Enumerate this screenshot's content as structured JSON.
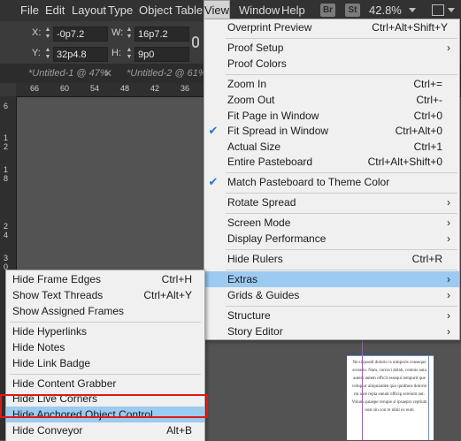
{
  "menubar": {
    "items": [
      "File",
      "Edit",
      "Layout",
      "Type",
      "Object",
      "Table",
      "View",
      "Window",
      "Help"
    ],
    "active": "View",
    "badges": [
      "Br",
      "St"
    ],
    "zoom": "42.8%"
  },
  "control": {
    "x_label": "X:",
    "x_value": "-0p7.2",
    "y_label": "Y:",
    "y_value": "32p4.8",
    "w_label": "W:",
    "w_value": "16p7.2",
    "h_label": "H:",
    "h_value": "9p0"
  },
  "tabs": [
    {
      "label": "*Untitled-1 @ 47%"
    },
    {
      "label": "*Untitled-2 @ 61%"
    }
  ],
  "ruler": {
    "h_ticks": [
      "66",
      "60",
      "54",
      "48",
      "42",
      "36"
    ],
    "v_ticks": [
      "6",
      "1",
      "2",
      "1",
      "8",
      "2",
      "4",
      "3",
      "0",
      "3"
    ]
  },
  "view_menu": {
    "items": [
      {
        "label": "Overprint Preview",
        "shortcut": "Ctrl+Alt+Shift+Y"
      },
      {
        "label": "Proof Setup",
        "submenu": true
      },
      {
        "label": "Proof Colors"
      },
      {
        "label": "Zoom In",
        "shortcut": "Ctrl+="
      },
      {
        "label": "Zoom Out",
        "shortcut": "Ctrl+-"
      },
      {
        "label": "Fit Page in Window",
        "shortcut": "Ctrl+0"
      },
      {
        "label": "Fit Spread in Window",
        "shortcut": "Ctrl+Alt+0",
        "checked": true
      },
      {
        "label": "Actual Size",
        "shortcut": "Ctrl+1"
      },
      {
        "label": "Entire Pasteboard",
        "shortcut": "Ctrl+Alt+Shift+0"
      },
      {
        "label": "Match Pasteboard to Theme Color",
        "checked": true
      },
      {
        "label": "Rotate Spread",
        "submenu": true
      },
      {
        "label": "Screen Mode",
        "submenu": true
      },
      {
        "label": "Display Performance",
        "submenu": true
      },
      {
        "label": "Hide Rulers",
        "shortcut": "Ctrl+R"
      },
      {
        "label": "Extras",
        "submenu": true,
        "highlighted": true
      },
      {
        "label": "Grids & Guides",
        "submenu": true
      },
      {
        "label": "Structure",
        "submenu": true
      },
      {
        "label": "Story Editor",
        "submenu": true
      }
    ]
  },
  "extras_menu": {
    "items": [
      {
        "label": "Hide Frame Edges",
        "shortcut": "Ctrl+H"
      },
      {
        "label": "Show Text Threads",
        "shortcut": "Ctrl+Alt+Y"
      },
      {
        "label": "Show Assigned Frames"
      },
      {
        "label": "Hide Hyperlinks"
      },
      {
        "label": "Hide Notes"
      },
      {
        "label": "Hide Link Badge"
      },
      {
        "label": "Hide Content Grabber"
      },
      {
        "label": "Hide Live Corners"
      },
      {
        "label": "Hide Anchored Object Control",
        "highlighted": true
      },
      {
        "label": "Hide Conveyor",
        "shortcut": "Alt+B"
      }
    ]
  },
  "page_text": "Ne si ipsodi dolorio is nimporis conseque sceratio. Nam, corrovi dolab, comnis auta autem autem officit essequi tempurit que voluptur aliquianden quo quidmos dolorio mi aute repta eaiunt officip sereium aut. Volum quiaepe rerupie si ipsaepro reptium nost sin con re nihil ex eum"
}
